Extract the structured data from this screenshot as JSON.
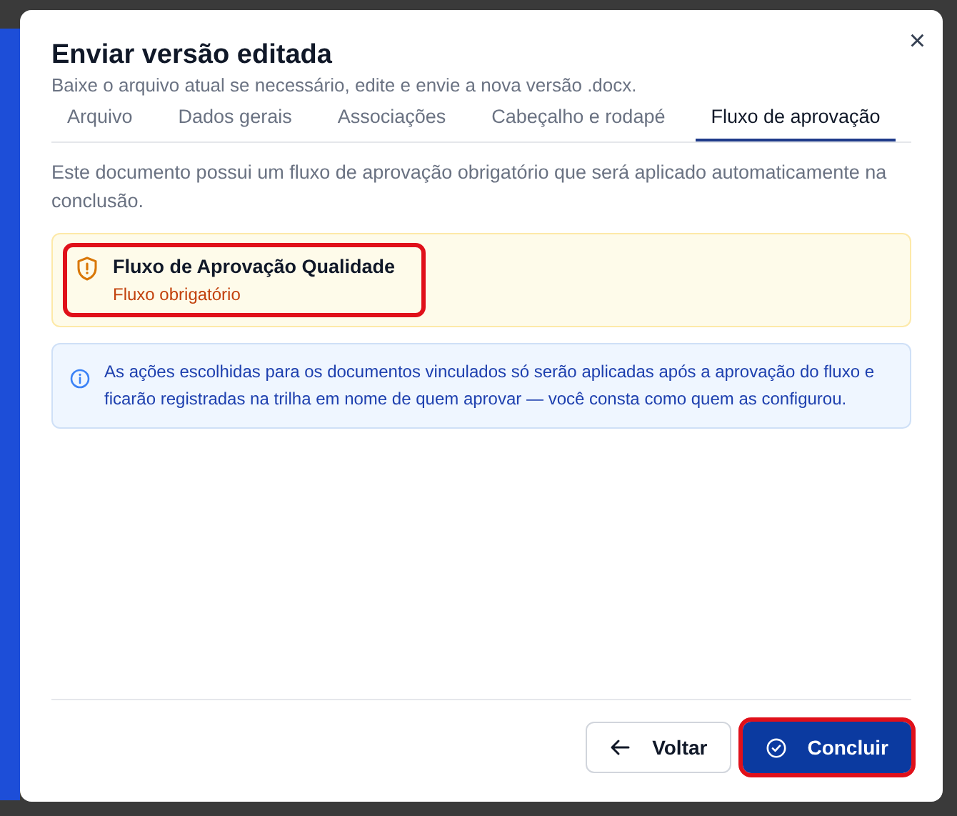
{
  "dialog": {
    "title": "Enviar versão editada",
    "subtitle": "Baixe o arquivo atual se necessário, edite e envie a nova versão .docx.",
    "close": "×"
  },
  "tabs": [
    {
      "label": "Arquivo",
      "selected": false
    },
    {
      "label": "Dados gerais",
      "selected": false
    },
    {
      "label": "Associações",
      "selected": false
    },
    {
      "label": "Cabeçalho e rodapé",
      "selected": false
    },
    {
      "label": "Fluxo de aprovação",
      "selected": true
    }
  ],
  "description": "Este documento possui um fluxo de aprovação obrigatório que será aplicado automaticamente na conclusão.",
  "flow": {
    "name": "Fluxo de Aprovação Qualidade",
    "tag": "Fluxo obrigatório",
    "highlighted": true
  },
  "info": "As ações escolhidas para os documentos vinculados só serão aplicadas após a aprovação do fluxo e ficarão registradas na trilha em nome de quem aprovar — você consta como quem as configurou.",
  "buttons": [
    {
      "label": "Voltar",
      "kind": "back",
      "highlighted": false
    },
    {
      "label": "Concluir",
      "kind": "primary",
      "highlighted": true
    }
  ]
}
